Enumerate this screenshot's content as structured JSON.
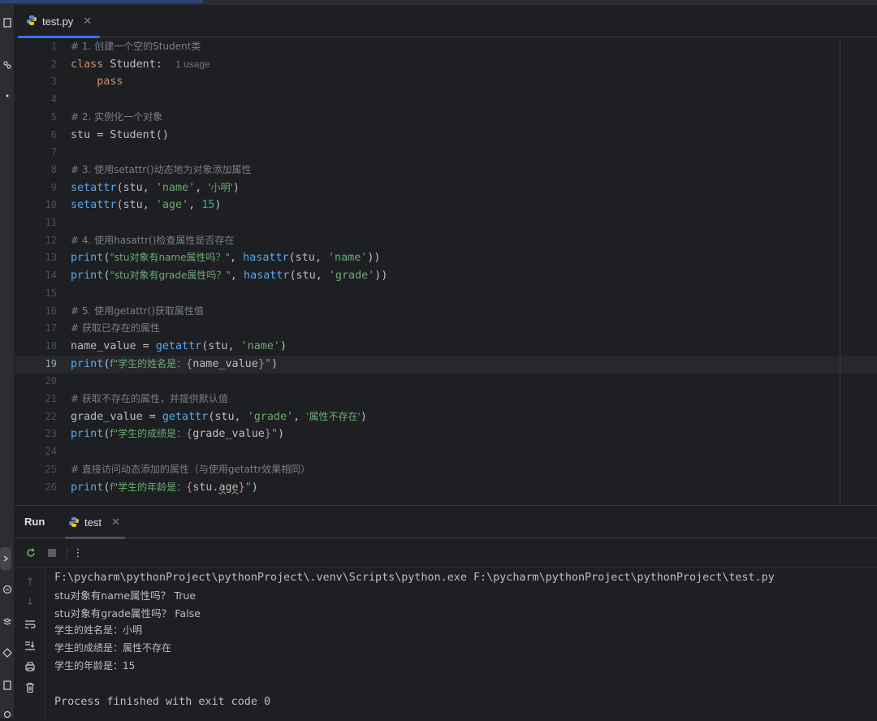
{
  "editor": {
    "tab_name": "test.py",
    "hint_usage": "1 usage",
    "current_line": 19,
    "line_numbers": [
      "1",
      "2",
      "3",
      "4",
      "5",
      "6",
      "7",
      "8",
      "9",
      "10",
      "11",
      "12",
      "13",
      "14",
      "15",
      "16",
      "17",
      "18",
      "19",
      "20",
      "21",
      "22",
      "23",
      "24",
      "25",
      "26"
    ],
    "code": {
      "l1_comment": "# 1. 创建一个空的Student类",
      "l2_kw": "class",
      "l2_rest": " Student:",
      "l3_kw": "pass",
      "l5_comment": "# 2. 实例化一个对象",
      "l6_code": "stu = Student()",
      "l8_comment": "# 3. 使用setattr()动态地为对象添加属性",
      "l9_fn": "setattr",
      "l9_a": "(stu, ",
      "l9_s1": "'name'",
      "l9_b": ", ",
      "l9_s2": "'小明'",
      "l9_c": ")",
      "l10_fn": "setattr",
      "l10_a": "(stu, ",
      "l10_s1": "'age'",
      "l10_b": ", ",
      "l10_num": "15",
      "l10_c": ")",
      "l12_comment": "# 4. 使用hasattr()检查属性是否存在",
      "l13_fn": "print",
      "l13_a": "(",
      "l13_s": "\"stu对象有name属性吗？\"",
      "l13_b": ", ",
      "l13_fn2": "hasattr",
      "l13_c": "(stu, ",
      "l13_s2": "'name'",
      "l13_d": "))",
      "l14_fn": "print",
      "l14_a": "(",
      "l14_s": "\"stu对象有grade属性吗？\"",
      "l14_b": ", ",
      "l14_fn2": "hasattr",
      "l14_c": "(stu, ",
      "l14_s2": "'grade'",
      "l14_d": "))",
      "l16_comment": "# 5. 使用getattr()获取属性值",
      "l17_comment": "# 获取已存在的属性",
      "l18_a": "name_value = ",
      "l18_fn": "getattr",
      "l18_b": "(stu, ",
      "l18_s": "'name'",
      "l18_c": ")",
      "l19_fn": "print",
      "l19_a": "(",
      "l19_s1": "f\"学生的姓名是：",
      "l19_ob": "{",
      "l19_var": "name_value",
      "l19_cb": "}",
      "l19_s2": "\"",
      "l19_c": ")",
      "l21_comment": "# 获取不存在的属性，并提供默认值",
      "l22_a": "grade_value = ",
      "l22_fn": "getattr",
      "l22_b": "(stu, ",
      "l22_s1": "'grade'",
      "l22_c": ", ",
      "l22_s2": "'属性不存在'",
      "l22_d": ")",
      "l23_fn": "print",
      "l23_a": "(",
      "l23_s1": "f\"学生的成绩是：",
      "l23_ob": "{",
      "l23_var": "grade_value",
      "l23_cb": "}",
      "l23_s2": "\"",
      "l23_c": ")",
      "l25_comment": "# 直接访问动态添加的属性（与使用getattr效果相同）",
      "l26_fn": "print",
      "l26_a": "(",
      "l26_s1": "f\"学生的年龄是：",
      "l26_ob": "{",
      "l26_var1": "stu.",
      "l26_var2": "age",
      "l26_cb": "}",
      "l26_s2": "\"",
      "l26_c": ")"
    }
  },
  "run": {
    "label": "Run",
    "tab_name": "test",
    "output": [
      "F:\\pycharm\\pythonProject\\pythonProject\\.venv\\Scripts\\python.exe F:\\pycharm\\pythonProject\\pythonProject\\test.py",
      "stu对象有name属性吗？ True",
      "stu对象有grade属性吗？ False",
      "学生的姓名是：小明",
      "学生的成绩是：属性不存在",
      "学生的年龄是：15",
      "",
      "Process finished with exit code 0"
    ]
  },
  "icons": {
    "python_file": "python-file-icon",
    "rerun": "rerun-icon",
    "stop": "stop-icon",
    "more": "more-options-icon",
    "scroll_up": "arrow-up-icon",
    "scroll_down": "arrow-down-icon",
    "soft_wrap": "soft-wrap-icon",
    "scroll_end": "scroll-to-end-icon",
    "print": "print-icon",
    "trash": "trash-icon"
  },
  "colors": {
    "background": "#1e1f22",
    "accent": "#3574f0",
    "keyword": "#cf8e6d",
    "string": "#6aab73",
    "function": "#56a8f5",
    "number": "#2aacb8",
    "comment": "#7a7e85"
  }
}
